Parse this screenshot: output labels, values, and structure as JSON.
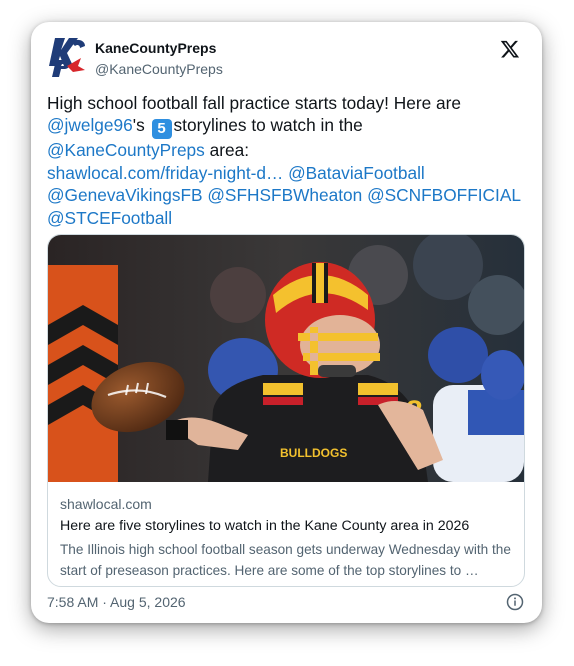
{
  "author": {
    "name": "KaneCountyPreps",
    "handle": "@KaneCountyPreps",
    "logo_text": "KCP",
    "icon": "kcp-logo"
  },
  "close_icon": "x-logo-icon",
  "tweet": {
    "line1": "High school football fall practice starts today! Here are",
    "mention_author": "@jwelge96",
    "possessive": "'s",
    "number_badge": "5",
    "line2_rest": "storylines to watch in the",
    "mention_kcp": "@KaneCountyPreps",
    "area_text": " area:",
    "url": "shawlocal.com/friday-night-d…",
    "mention_batavia": "@BataviaFootball",
    "mention_geneva": "@GenevaVikingsFB",
    "mention_wheaton": "@SFHSFBWheaton",
    "mention_scn": "@SCNFBOFFICIAL",
    "mention_stce": "@STCEFootball"
  },
  "link_card": {
    "domain": "shawlocal.com",
    "title": "Here are five storylines to watch in the Kane County area in 2026",
    "description": "The Illinois high school football season gets underway Wednesday with the start of preseason practices. Here are some of the top storylines to …",
    "jersey_text": "BULLDOGS",
    "jersey_number": "8"
  },
  "meta": {
    "time": "7:58 AM",
    "separator": " · ",
    "date": "Aug 5, 2026",
    "info_icon": "info-icon"
  },
  "colors": {
    "link": "#1d78c7",
    "badge": "#2f8fe0",
    "text": "#0f1419",
    "muted": "#536471"
  }
}
